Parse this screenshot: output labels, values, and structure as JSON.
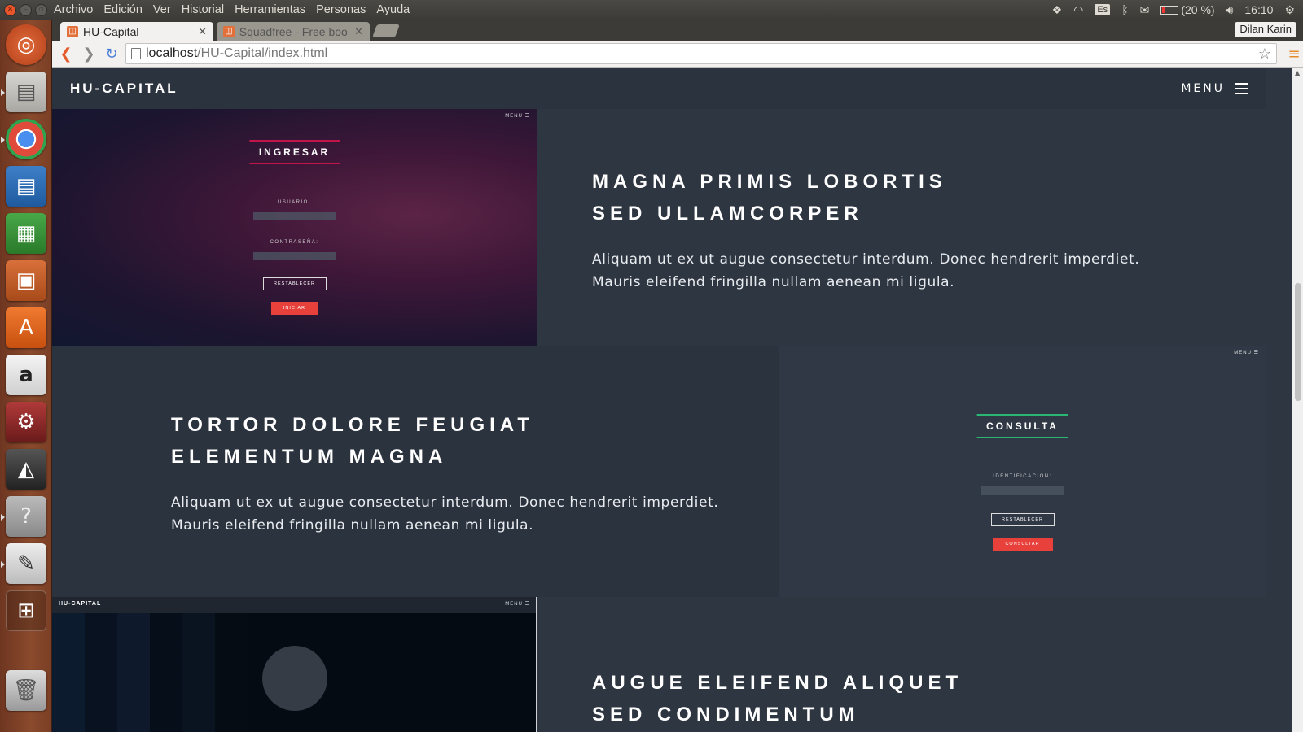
{
  "top_panel": {
    "menus": [
      "Archivo",
      "Edición",
      "Ver",
      "Historial",
      "Herramientas",
      "Personas",
      "Ayuda"
    ],
    "keyboard": "Es",
    "battery": "(20 %)",
    "battery_level": 0.2,
    "clock": "16:10"
  },
  "launcher": {
    "items": [
      "ubuntu-dash-icon",
      "files-icon",
      "chrome-icon",
      "writer-icon",
      "calc-icon",
      "impress-icon",
      "software-center-icon",
      "amazon-icon",
      "system-settings-icon",
      "inkscape-icon",
      "help-icon",
      "text-editor-icon",
      "workspace-switcher-icon",
      "trash-icon"
    ]
  },
  "browser": {
    "tabs": [
      {
        "title": "HU-Capital",
        "active": true
      },
      {
        "title": "Squadfree - Free boo",
        "active": false
      }
    ],
    "profile": "Dilan Karin",
    "url_host": "localhost",
    "url_path": "/HU-Capital/index.html"
  },
  "site": {
    "brand": "HU-CAPITAL",
    "menu_label": "MENU",
    "spotlights": [
      {
        "title_line1": "MAGNA PRIMIS LOBORTIS",
        "title_line2": "SED ULLAMCORPER",
        "body": "Aliquam ut ex ut augue consectetur interdum. Donec hendrerit imperdiet. Mauris eleifend fringilla nullam aenean mi ligula.",
        "shot": {
          "menu": "MENU ☰",
          "title": "INGRESAR",
          "accent": "#c0144a",
          "label1": "USUARIO:",
          "label2": "CONTRASEÑA:",
          "btn_outline": "RESTABLECER",
          "btn_primary": "INICIAR"
        }
      },
      {
        "title_line1": "TORTOR DOLORE FEUGIAT",
        "title_line2": "ELEMENTUM MAGNA",
        "body": "Aliquam ut ex ut augue consectetur interdum. Donec hendrerit imperdiet. Mauris eleifend fringilla nullam aenean mi ligula.",
        "shot": {
          "menu": "MENU ☰",
          "title": "CONSULTA",
          "accent": "#2bb673",
          "label1": "IDENTIFICACIÓN:",
          "btn_outline": "RESTABLECER",
          "btn_primary": "CONSULTAR"
        }
      },
      {
        "title_line1": "AUGUE ELEIFEND ALIQUET",
        "title_line2": "SED CONDIMENTUM",
        "shot": {
          "brand": "HU-CAPITAL",
          "menu": "MENU ☰"
        }
      }
    ]
  }
}
